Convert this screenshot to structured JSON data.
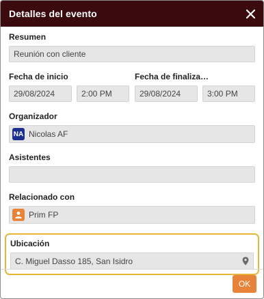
{
  "dialog": {
    "title": "Detalles del evento",
    "ok_label": "OK"
  },
  "summary": {
    "label": "Resumen",
    "value": "Reunión con cliente"
  },
  "start": {
    "label": "Fecha de inicio",
    "date": "29/08/2024",
    "time": "2:00 PM"
  },
  "end": {
    "label": "Fecha de finaliza…",
    "date": "29/08/2024",
    "time": "3:00 PM"
  },
  "organizer": {
    "label": "Organizador",
    "initials": "NA",
    "name": "Nicolas AF"
  },
  "attendees": {
    "label": "Asistentes",
    "value": ""
  },
  "related": {
    "label": "Relacionado con",
    "name": "Prim FP"
  },
  "location": {
    "label": "Ubicación",
    "value": "C. Miguel Dasso 185, San Isidro"
  },
  "colors": {
    "header": "#3a0a0f",
    "accent": "#e8843a",
    "focus": "#e8b53a",
    "organizer_avatar": "#1e2e8c"
  },
  "icons": {
    "close": "close-icon",
    "location": "map-pin-icon",
    "contact": "person-icon"
  }
}
